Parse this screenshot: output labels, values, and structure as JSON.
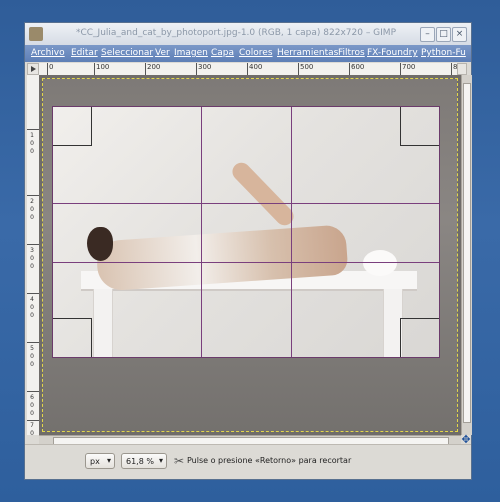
{
  "window": {
    "title": "*CC_Julia_and_cat_by_photoport.jpg-1.0 (RGB, 1 capa) 822x720 – GIMP"
  },
  "menu": {
    "items": [
      "Archivo",
      "Editar",
      "Seleccionar",
      "Ver",
      "Imagen",
      "Capa",
      "Colores",
      "Herramientas",
      "Filtros",
      "FX-Foundry",
      "Python-Fu"
    ]
  },
  "rulers": {
    "horizontal_labels": [
      "0",
      "100",
      "200",
      "300",
      "400",
      "500",
      "600",
      "700",
      "800"
    ],
    "vertical_labels": [
      "1",
      "0",
      "0",
      "2",
      "0",
      "0",
      "3",
      "0",
      "0",
      "4",
      "0",
      "0",
      "5",
      "0",
      "0",
      "6",
      "0",
      "0",
      "7",
      "0",
      "0",
      "8",
      "0",
      "0"
    ]
  },
  "statusbar": {
    "unit": "px",
    "zoom": "61,8 %",
    "hint": "Pulse o presione «Retorno» para recortar"
  },
  "icons": {
    "app": "gimp-icon",
    "nav": "navigate-icon",
    "move": "move-icon",
    "crop_tool": "crop-tool-icon"
  },
  "colors": {
    "guide": "#7a3f7d",
    "selection": "#e2d64a"
  }
}
